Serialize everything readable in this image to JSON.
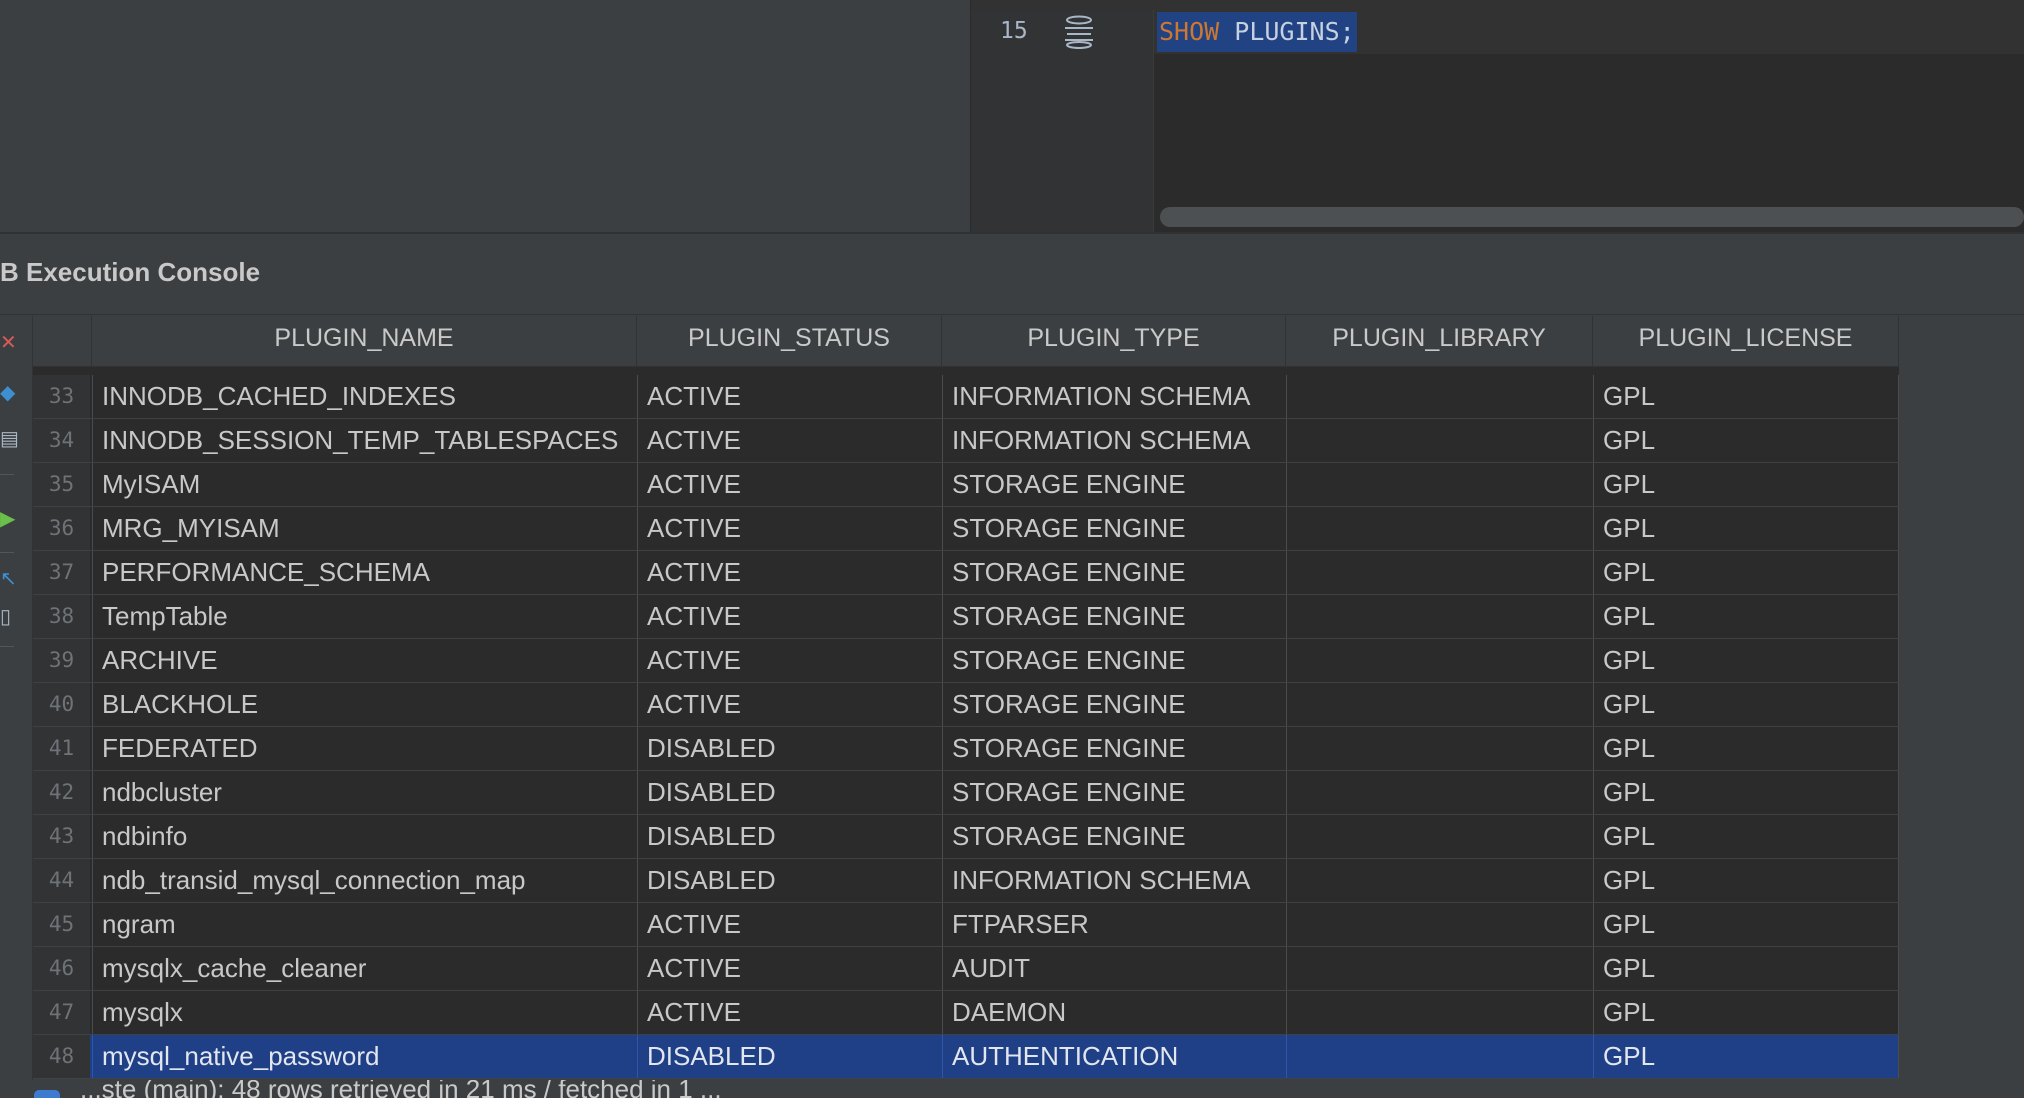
{
  "editor": {
    "line_number": "15",
    "code_keyword": "SHOW",
    "code_rest": " PLUGINS;"
  },
  "console": {
    "title": "B Execution Console"
  },
  "table": {
    "columns": [
      "PLUGIN_NAME",
      "PLUGIN_STATUS",
      "PLUGIN_TYPE",
      "PLUGIN_LIBRARY",
      "PLUGIN_LICENSE"
    ],
    "rows": [
      {
        "num": "33",
        "name": "INNODB_CACHED_INDEXES",
        "status": "ACTIVE",
        "type": "INFORMATION SCHEMA",
        "library": "",
        "license": "GPL"
      },
      {
        "num": "34",
        "name": "INNODB_SESSION_TEMP_TABLESPACES",
        "status": "ACTIVE",
        "type": "INFORMATION SCHEMA",
        "library": "",
        "license": "GPL"
      },
      {
        "num": "35",
        "name": "MyISAM",
        "status": "ACTIVE",
        "type": "STORAGE ENGINE",
        "library": "",
        "license": "GPL"
      },
      {
        "num": "36",
        "name": "MRG_MYISAM",
        "status": "ACTIVE",
        "type": "STORAGE ENGINE",
        "library": "",
        "license": "GPL"
      },
      {
        "num": "37",
        "name": "PERFORMANCE_SCHEMA",
        "status": "ACTIVE",
        "type": "STORAGE ENGINE",
        "library": "",
        "license": "GPL"
      },
      {
        "num": "38",
        "name": "TempTable",
        "status": "ACTIVE",
        "type": "STORAGE ENGINE",
        "library": "",
        "license": "GPL"
      },
      {
        "num": "39",
        "name": "ARCHIVE",
        "status": "ACTIVE",
        "type": "STORAGE ENGINE",
        "library": "",
        "license": "GPL"
      },
      {
        "num": "40",
        "name": "BLACKHOLE",
        "status": "ACTIVE",
        "type": "STORAGE ENGINE",
        "library": "",
        "license": "GPL"
      },
      {
        "num": "41",
        "name": "FEDERATED",
        "status": "DISABLED",
        "type": "STORAGE ENGINE",
        "library": "",
        "license": "GPL"
      },
      {
        "num": "42",
        "name": "ndbcluster",
        "status": "DISABLED",
        "type": "STORAGE ENGINE",
        "library": "",
        "license": "GPL"
      },
      {
        "num": "43",
        "name": "ndbinfo",
        "status": "DISABLED",
        "type": "STORAGE ENGINE",
        "library": "",
        "license": "GPL"
      },
      {
        "num": "44",
        "name": "ndb_transid_mysql_connection_map",
        "status": "DISABLED",
        "type": "INFORMATION SCHEMA",
        "library": "",
        "license": "GPL"
      },
      {
        "num": "45",
        "name": "ngram",
        "status": "ACTIVE",
        "type": "FTPARSER",
        "library": "",
        "license": "GPL"
      },
      {
        "num": "46",
        "name": "mysqlx_cache_cleaner",
        "status": "ACTIVE",
        "type": "AUDIT",
        "library": "",
        "license": "GPL"
      },
      {
        "num": "47",
        "name": "mysqlx",
        "status": "ACTIVE",
        "type": "DAEMON",
        "library": "",
        "license": "GPL"
      },
      {
        "num": "48",
        "name": "mysql_native_password",
        "status": "DISABLED",
        "type": "AUTHENTICATION",
        "library": "",
        "license": "GPL",
        "selected": true
      }
    ]
  },
  "status_bar": {
    "text": "...ste (main): 48 rows retrieved in 21 ms / fetched in 1 ..."
  },
  "colors": {
    "keyword": "#cc7832",
    "selection": "#1f3f86",
    "code_highlight": "#214283"
  }
}
